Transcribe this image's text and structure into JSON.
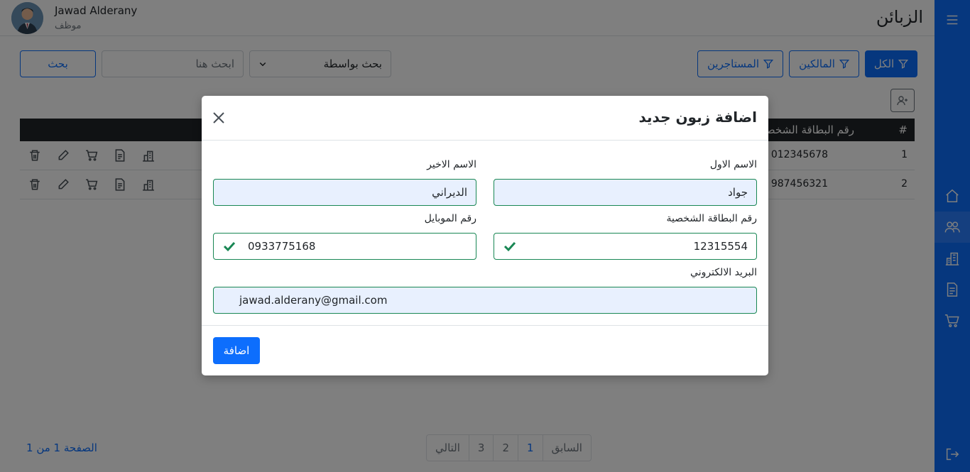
{
  "header": {
    "user_name": "Jawad Alderany",
    "user_role": "موظف",
    "page_title": "الزبائن"
  },
  "toolbar": {
    "filter_all": "الكل",
    "filter_owners": "المالكين",
    "filter_tenants": "المستاجرين",
    "search_by": "بحث بواسطة",
    "search_placeholder": "ابحث هنا",
    "search_button": "بحث"
  },
  "table": {
    "headers": {
      "hash": "#",
      "id_number": "رقم البطاقة الشخصية"
    },
    "rows": [
      {
        "num": "1",
        "id_number": "012345678"
      },
      {
        "num": "2",
        "id_number": "987456321"
      }
    ]
  },
  "pagination": {
    "prev": "السابق",
    "pages": [
      "1",
      "2",
      "3"
    ],
    "next": "التالي",
    "info": "الصفحة 1 من 1"
  },
  "modal": {
    "title": "اضافة زبون جديد",
    "first_name_label": "الاسم الاول",
    "first_name_value": "جواد",
    "last_name_label": "الاسم الاخير",
    "last_name_value": "الديراني",
    "id_label": "رقم البطاقة الشخصية",
    "id_value": "12315554",
    "mobile_label": "رقم الموبايل",
    "mobile_value": "0933775168",
    "email_label": "البريد الالكتروني",
    "email_value": "jawad.alderany@gmail.com",
    "submit": "اضافة"
  },
  "colors": {
    "primary": "#0d6efd",
    "success": "#198754",
    "dark": "#212529",
    "autofill": "#e8f0fe"
  },
  "icons": [
    "menu-icon",
    "home-icon",
    "users-icon",
    "building-icon",
    "document-icon",
    "cart-icon",
    "logout-icon",
    "filter-icon",
    "chevron-down-icon",
    "user-plus-icon",
    "trash-icon",
    "edit-icon",
    "close-icon",
    "check-icon"
  ]
}
